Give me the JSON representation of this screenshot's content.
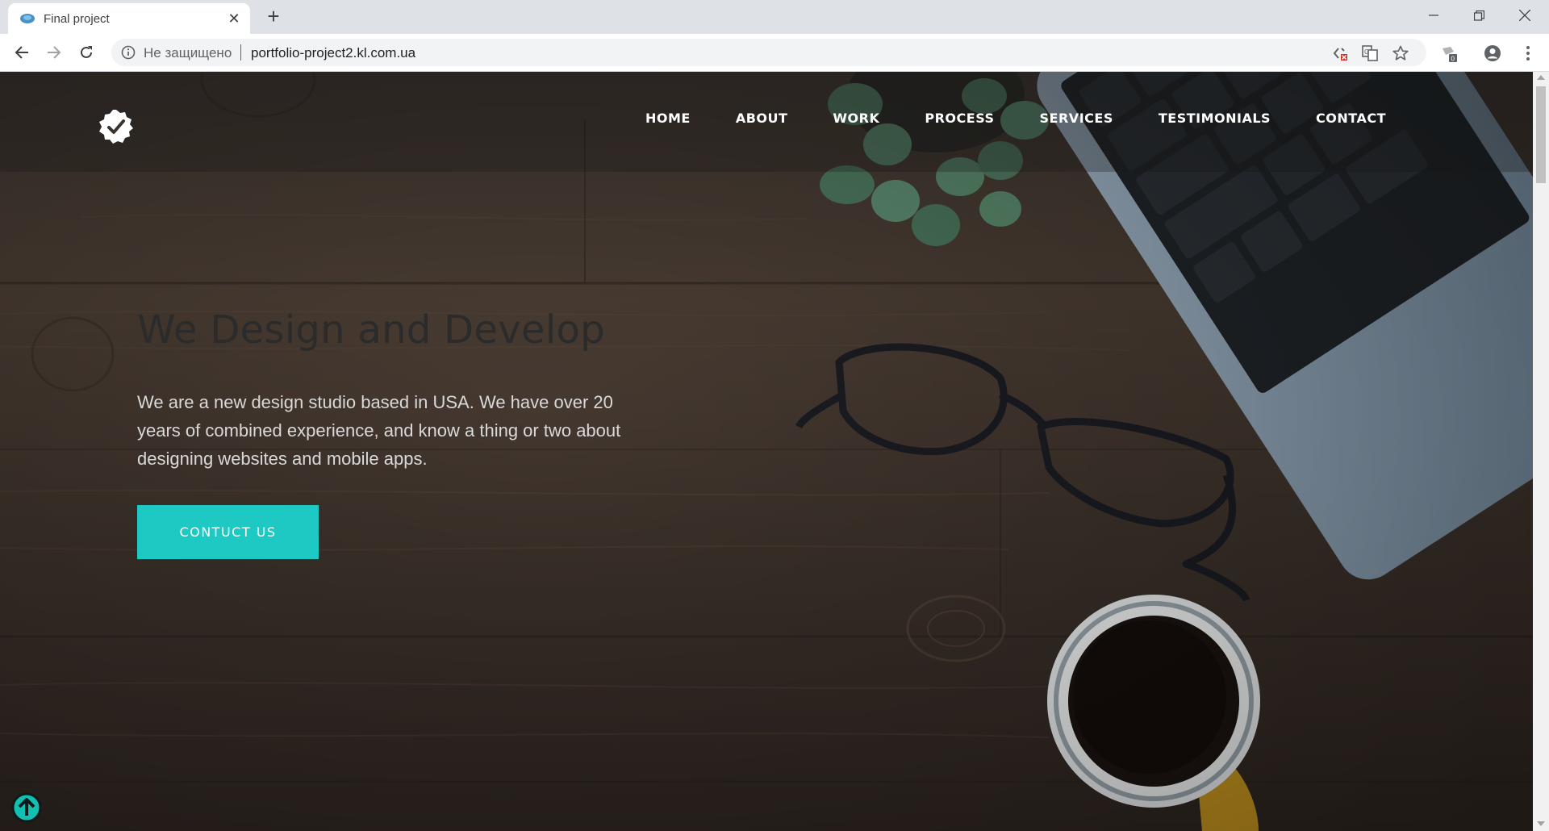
{
  "browser": {
    "tab_title": "Final project",
    "tab_close": "✕",
    "new_tab": "+",
    "security_label": "Не защищено",
    "url": "portfolio-project2.kl.com.ua"
  },
  "site": {
    "nav": [
      "HOME",
      "ABOUT",
      "WORK",
      "PROCESS",
      "SERVICES",
      "TESTIMONIALS",
      "CONTACT"
    ],
    "hero_title": "We Design and Develop",
    "hero_text": "We are a new design studio based in USA. We have over 20 years of combined experience, and know a thing or two about designing websites and mobile apps.",
    "cta_label": "CONTUCT US"
  },
  "colors": {
    "accent": "#1fc9c3",
    "chrome_bg": "#dee1e6"
  },
  "icons": [
    "favicon-icon",
    "close-icon",
    "plus-icon",
    "minimize-icon",
    "restore-icon",
    "window-close-icon",
    "back-icon",
    "forward-icon",
    "reload-icon",
    "info-icon",
    "translate-off-icon",
    "translate-icon",
    "star-icon",
    "extension-icon",
    "account-icon",
    "menu-icon",
    "check-badge-icon",
    "arrow-up-icon"
  ]
}
